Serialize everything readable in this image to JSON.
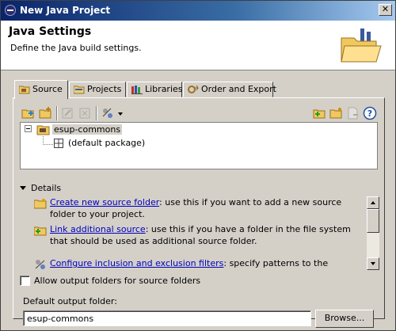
{
  "window": {
    "title": "New Java Project"
  },
  "header": {
    "title": "Java Settings",
    "description": "Define the Java build settings."
  },
  "tabs": [
    {
      "label": "Source",
      "icon": "source-folder-icon",
      "active": true
    },
    {
      "label": "Projects",
      "icon": "projects-icon",
      "active": false
    },
    {
      "label": "Libraries",
      "icon": "libraries-icon",
      "active": false
    },
    {
      "label": "Order and Export",
      "icon": "order-export-icon",
      "active": false
    }
  ],
  "tree": {
    "project": "esup-commons",
    "package": "(default package)"
  },
  "details": {
    "label": "Details",
    "items": [
      {
        "icon": "folder-new-icon",
        "link": "Create new source folder",
        "text": ": use this if you want to add a new source folder to your project."
      },
      {
        "icon": "link-source-icon",
        "link": "Link additional source",
        "text": ": use this if you have a folder in the file system that should be used as additional source folder."
      },
      {
        "icon": "filter-icon",
        "link": "Configure inclusion and exclusion filters",
        "text": ": specify patterns to the inclusion and"
      }
    ]
  },
  "options": {
    "allow_output_folders": "Allow output folders for source folders",
    "allow_output_folders_checked": false
  },
  "output": {
    "label": "Default output folder:",
    "value": "esup-commons",
    "browse_label": "Browse..."
  }
}
